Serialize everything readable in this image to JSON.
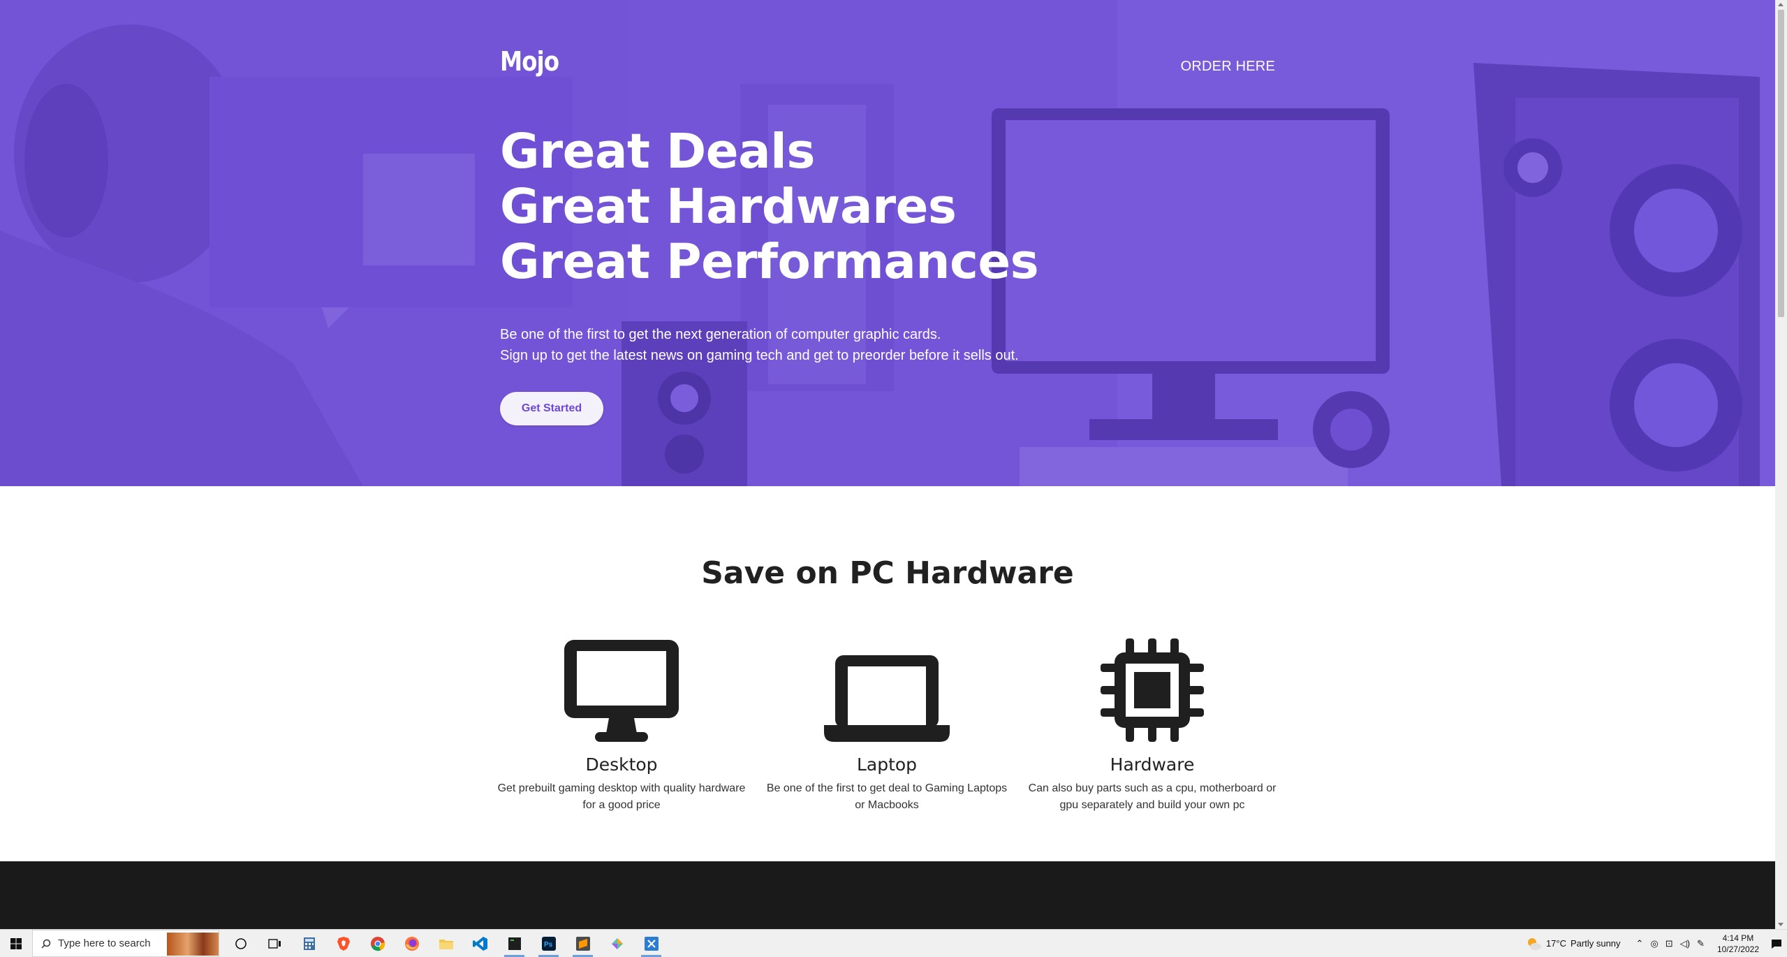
{
  "nav": {
    "logo": "Mojo",
    "order_link": "ORDER HERE"
  },
  "hero": {
    "headline": [
      "Great Deals",
      "Great Hardwares",
      "Great Performances"
    ],
    "subtext": [
      "Be one of the first to get the next generation of computer graphic cards.",
      "Sign up to get the latest news on gaming tech and get to preorder before it sells out."
    ],
    "cta_label": "Get Started"
  },
  "features": {
    "title": "Save on PC Hardware",
    "items": [
      {
        "icon": "desktop-icon",
        "title": "Desktop",
        "desc": "Get prebuilt gaming desktop with quality hardware for a good price"
      },
      {
        "icon": "laptop-icon",
        "title": "Laptop",
        "desc": "Be one of the first to get deal to Gaming Laptops or Macbooks"
      },
      {
        "icon": "chip-icon",
        "title": "Hardware",
        "desc": "Can also buy parts such as a cpu, motherboard or gpu separately and build your own pc"
      }
    ]
  },
  "taskbar": {
    "search_placeholder": "Type here to search",
    "apps": [
      "task-view-icon",
      "widgets-icon",
      "calculator-icon",
      "brave-icon",
      "chrome-icon",
      "firefox-icon",
      "file-explorer-icon",
      "vscode-icon",
      "terminal-icon",
      "photoshop-icon",
      "sublime-icon",
      "figma-icon",
      "snipping-tool-icon"
    ],
    "weather": {
      "temp": "17°C",
      "condition": "Partly sunny"
    },
    "clock": {
      "time": "4:14 PM",
      "date": "10/27/2022"
    }
  },
  "colors": {
    "hero_bg": "#7454d6",
    "accent": "#6d48d6",
    "dark_section": "#1a1a1a"
  }
}
